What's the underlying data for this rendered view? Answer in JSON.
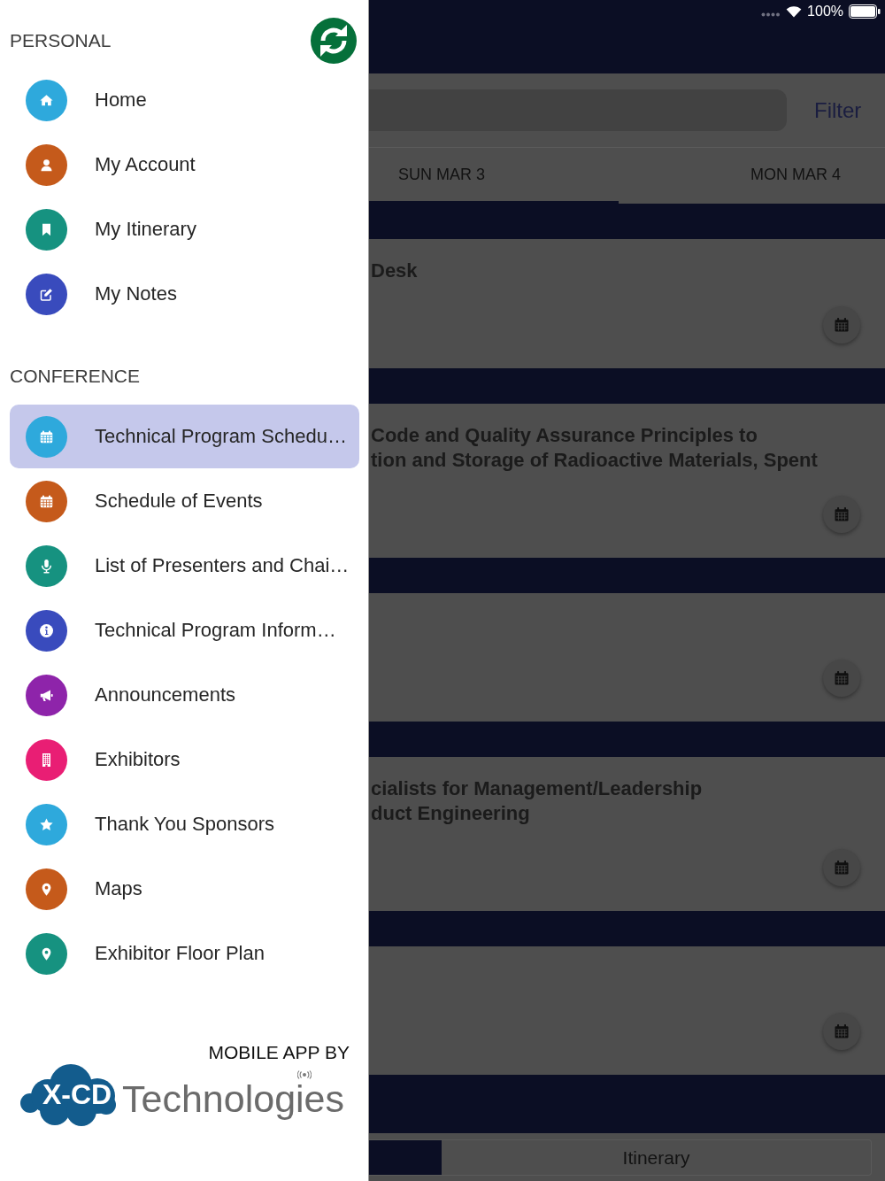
{
  "drawer": {
    "sections": [
      {
        "title": "PERSONAL",
        "items": [
          {
            "label": "Home",
            "kind": "home",
            "color": "#2ea9dc",
            "selected": false
          },
          {
            "label": "My Account",
            "kind": "account",
            "color": "#c55a1b",
            "selected": false
          },
          {
            "label": "My Itinerary",
            "kind": "bookmark",
            "color": "#169280",
            "selected": false
          },
          {
            "label": "My Notes",
            "kind": "notes",
            "color": "#394bbd",
            "selected": false
          }
        ]
      },
      {
        "title": "CONFERENCE",
        "items": [
          {
            "label": "Technical Program Schedu…",
            "kind": "calendar",
            "color": "#2ea9dc",
            "selected": true
          },
          {
            "label": "Schedule of Events",
            "kind": "calendar",
            "color": "#c55a1b",
            "selected": false
          },
          {
            "label": "List of Presenters and Chai…",
            "kind": "microphone",
            "color": "#169280",
            "selected": false
          },
          {
            "label": "Technical Program Inform…",
            "kind": "info",
            "color": "#394bbd",
            "selected": false
          },
          {
            "label": "Announcements",
            "kind": "megaphone",
            "color": "#8e24aa",
            "selected": false
          },
          {
            "label": "Exhibitors",
            "kind": "building",
            "color": "#e91e74",
            "selected": false
          },
          {
            "label": "Thank You Sponsors",
            "kind": "star",
            "color": "#2ea9dc",
            "selected": false
          },
          {
            "label": "Maps",
            "kind": "pin",
            "color": "#c55a1b",
            "selected": false
          },
          {
            "label": "Exhibitor Floor Plan",
            "kind": "pin",
            "color": "#169280",
            "selected": false
          }
        ]
      }
    ],
    "credit": {
      "caption": "MOBILE APP BY",
      "logo_mark": "X-CD",
      "logo_word": "Technologies"
    }
  },
  "status_bar": {
    "battery": "100%"
  },
  "toolbar": {
    "filter": "Filter"
  },
  "date_tabs": [
    {
      "label": "SUN MAR 3",
      "selected": true
    },
    {
      "label": "MON MAR 4",
      "selected": false
    }
  ],
  "sessions": [
    {
      "title": "Desk",
      "calendar_button": true
    },
    {
      "title": "Code and Quality Assurance Principles to\ntion and Storage of Radioactive Materials, Spent",
      "calendar_button": true
    },
    {
      "calendar_button": true
    },
    {
      "title": "cialists for Management/Leadership\nduct Engineering",
      "calendar_button": true
    },
    {
      "calendar_button": true
    }
  ],
  "segments": [
    {
      "selected": true
    },
    {
      "label": "Itinerary",
      "selected": false
    }
  ]
}
